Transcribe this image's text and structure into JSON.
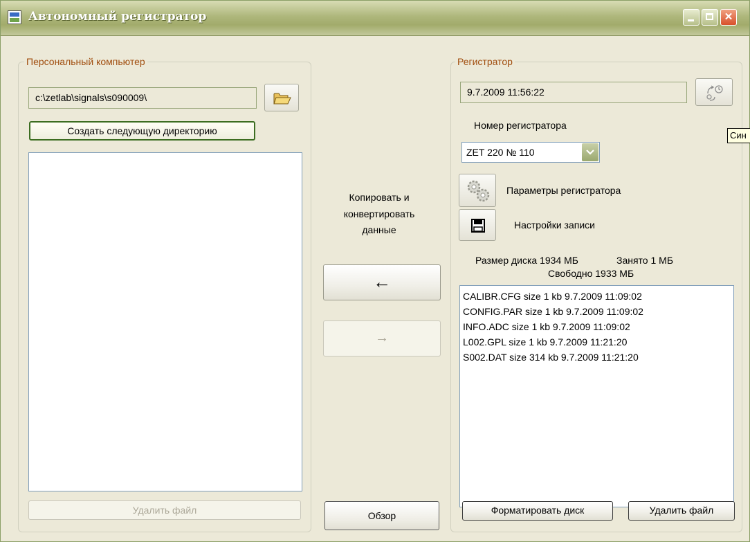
{
  "window": {
    "title": "Автономный регистратор"
  },
  "pc": {
    "group_label": "Персональный компьютер",
    "path": "c:\\zetlab\\signals\\s090009\\",
    "create_dir_label": "Создать следующую директорию",
    "files": [],
    "delete_label": "Удалить файл"
  },
  "middle": {
    "copy_line1": "Копировать и",
    "copy_line2": "конвертировать",
    "copy_line3": "данные",
    "to_pc_label": "←",
    "to_recorder_label": "→",
    "browse_label": "Обзор"
  },
  "recorder": {
    "group_label": "Регистратор",
    "datetime": "9.7.2009 11:56:22",
    "number_label": "Номер регистратора",
    "device_selected": "ZET 220 № 110",
    "params_label": "Параметры регистратора",
    "settings_label": "Настройки записи",
    "disk_size": "Размер диска 1934 МБ",
    "disk_used": "Занято 1 МБ",
    "disk_free": "Свободно 1933 МБ",
    "files": [
      "CALIBR.CFG  size 1 kb  9.7.2009 11:09:02",
      "CONFIG.PAR  size 1 kb  9.7.2009 11:09:02",
      "INFO.ADC  size 1 kb  9.7.2009 11:09:02",
      "L002.GPL  size 1 kb  9.7.2009 11:21:20",
      "S002.DAT  size 314 kb  9.7.2009 11:21:20"
    ],
    "format_label": "Форматировать диск",
    "delete_label": "Удалить файл"
  },
  "tooltip": {
    "text": "Син"
  },
  "icons": {
    "folder": "folder-open-icon",
    "sync": "sync-clock-icon",
    "gears": "gears-icon",
    "floppy": "floppy-disk-icon",
    "dropdown": "chevron-down-icon"
  },
  "colors": {
    "titlebar": "#a9b275",
    "group_label": "#a04d0e",
    "window_bg": "#ece9d8"
  }
}
